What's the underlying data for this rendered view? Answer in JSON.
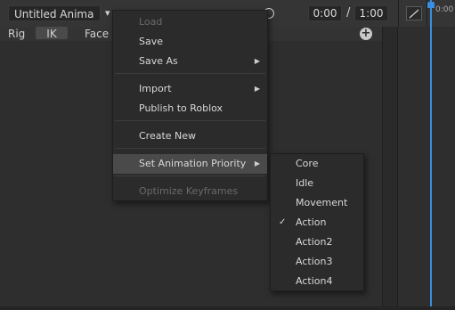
{
  "toolbar": {
    "animation_name": "Untitled Anima",
    "current_time": "0:00",
    "separator": "/",
    "end_time": "1:00",
    "partial_hidden_text": "▾  ııı ııı  ▸  ▶  ıı ııı",
    "timeline_label": "0:00"
  },
  "subbar": {
    "rig_label": "Rig",
    "ik_label": "IK",
    "face_label": "Face E",
    "plus_label": "+"
  },
  "menu": {
    "items": [
      {
        "label": "Load",
        "disabled": true
      },
      {
        "label": "Save"
      },
      {
        "label": "Save As",
        "arrow": "▶"
      },
      {
        "label": "Import",
        "arrow": "▶"
      },
      {
        "label": "Publish to Roblox"
      },
      {
        "label": "Create New"
      },
      {
        "label": "Set Animation Priority",
        "arrow": "▶"
      },
      {
        "label": "Optimize Keyframes",
        "disabled": true
      }
    ]
  },
  "submenu": {
    "items": [
      {
        "label": "Core"
      },
      {
        "label": "Idle"
      },
      {
        "label": "Movement"
      },
      {
        "label": "Action",
        "checked": "✓"
      },
      {
        "label": "Action2"
      },
      {
        "label": "Action3"
      },
      {
        "label": "Action4"
      }
    ]
  },
  "colors": {
    "accent": "#3a8de0",
    "background": "#2e2e2e",
    "menu_bg": "#2b2b2b",
    "highlight": "#4a4a4a"
  }
}
